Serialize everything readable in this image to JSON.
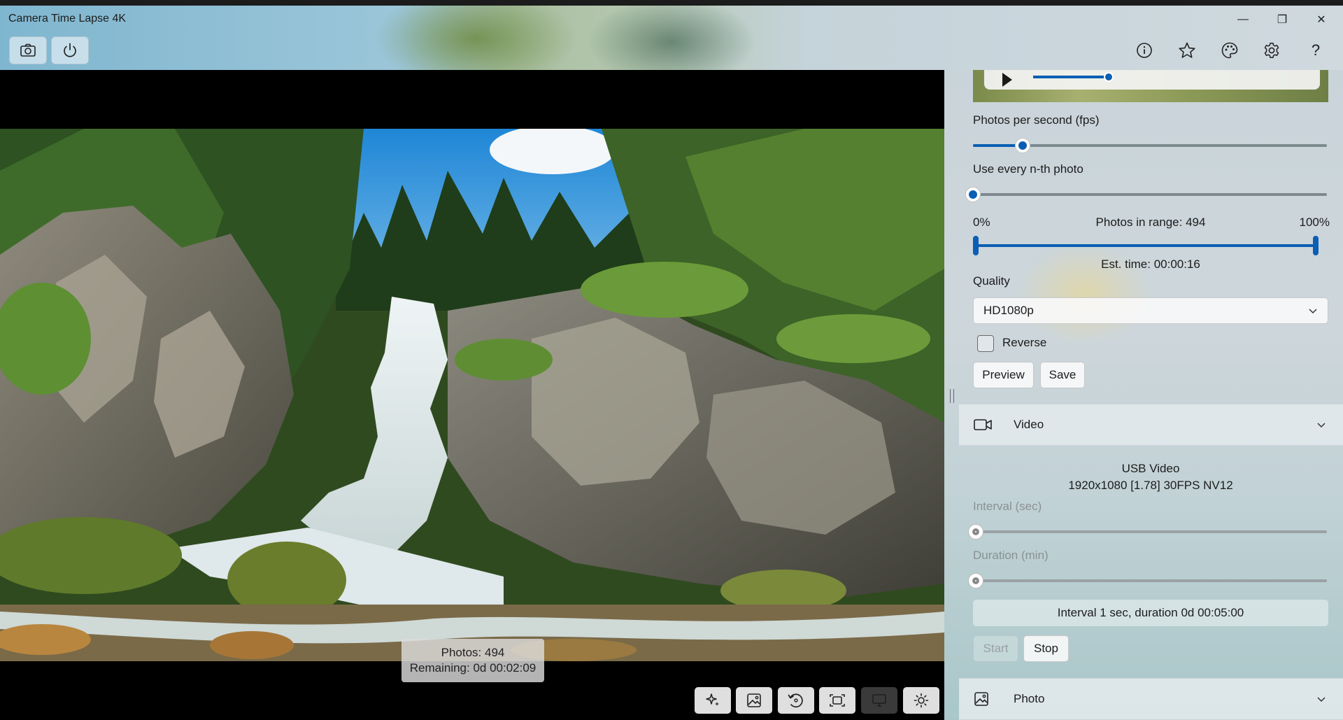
{
  "window": {
    "title": "Camera Time Lapse 4K",
    "minimize_glyph": "—",
    "restore_glyph": "❐",
    "close_glyph": "✕"
  },
  "toolbar": {
    "left_icons": [
      "camera-icon",
      "power-icon"
    ],
    "right_icons": [
      "info-icon",
      "star-icon",
      "palette-icon",
      "settings-icon",
      "help-icon"
    ],
    "help_glyph": "?"
  },
  "preview": {
    "overlay": {
      "photos": "Photos: 494",
      "remaining": "Remaining: 0d 00:02:09"
    },
    "bottom_tools": [
      "sparkle-icon",
      "image-icon",
      "rotate-icon",
      "fit-icon",
      "monitor-icon",
      "brightness-icon"
    ]
  },
  "timelapse": {
    "fps_label": "Photos per second (fps)",
    "fps_value_fraction": 0.14,
    "nth_label": "Use every n-th photo",
    "nth_value_fraction": 0.0,
    "range_min_label": "0%",
    "range_max_label": "100%",
    "range_center_label": "Photos in range: 494",
    "range_start_fraction": 0.0,
    "range_end_fraction": 1.0,
    "est_time": "Est. time: 00:00:16",
    "quality_label": "Quality",
    "quality_value": "HD1080p",
    "reverse_label": "Reverse",
    "reverse_checked": false,
    "preview_button": "Preview",
    "save_button": "Save"
  },
  "video_section": {
    "title": "Video",
    "device_name": "USB Video",
    "device_format": "1920x1080 [1.78] 30FPS NV12",
    "interval_label": "Interval (sec)",
    "interval_fraction": 0.0,
    "duration_label": "Duration (min)",
    "duration_fraction": 0.0,
    "summary": "Interval 1 sec, duration 0d 00:05:00",
    "start_button": "Start",
    "stop_button": "Stop"
  },
  "photo_section": {
    "title": "Photo"
  },
  "colors": {
    "accent": "#0a5fb4"
  }
}
